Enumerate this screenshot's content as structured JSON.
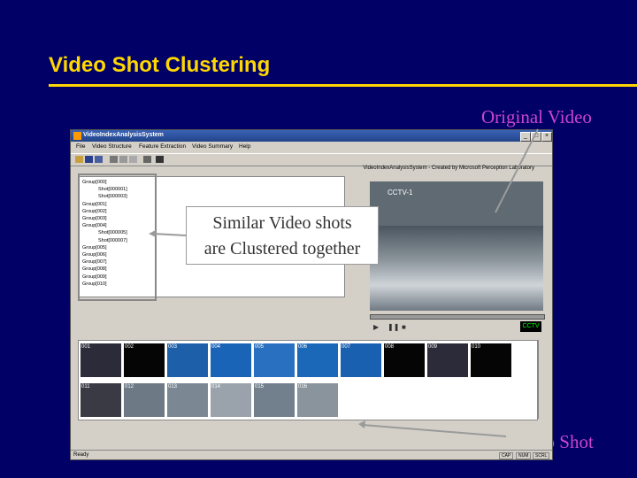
{
  "slide": {
    "title": "Video Shot Clustering",
    "callouts": {
      "original_video": "Original Video",
      "similar_line1": "Similar Video shots",
      "similar_line2": "are Clustered together",
      "video_shot": "Video Shot"
    },
    "colors": {
      "background": "#000066",
      "title": "#ffd700",
      "callout": "#cc44cc"
    }
  },
  "window": {
    "title": "VideoIndexAnalysisSystem",
    "menu": [
      "File",
      "Video Structure",
      "Feature Extraction",
      "Video Summary",
      "Help"
    ],
    "toolbar_icons": [
      "open-icon",
      "save-icon",
      "save-all-icon",
      "cut-icon",
      "copy-icon",
      "paste-icon",
      "print-icon",
      "help-icon"
    ],
    "caption": "VideoIndexAnalysisSystem - Created by Microsoft Perception Laboratory",
    "tree": [
      "Group[000]",
      "Shot[000001]",
      "Shot[000003]",
      "Group[001]",
      "Group[002]",
      "Group[003]",
      "Group[004]",
      "Shot[000005]",
      "Shot[000007]",
      "Group[005]",
      "Group[006]",
      "Group[007]",
      "Group[008]",
      "Group[009]",
      "Group[010]"
    ],
    "player": {
      "logo": "CCTV-1",
      "badge": "CCTV"
    },
    "shots_row1": [
      "001",
      "002",
      "003",
      "004",
      "005",
      "006",
      "007",
      "008",
      "009",
      "010"
    ],
    "shots_row2": [
      "011",
      "012",
      "013",
      "014",
      "015",
      "016"
    ],
    "status": {
      "ready": "Ready",
      "boxes": [
        "CAP",
        "NUM",
        "SCRL"
      ]
    }
  }
}
